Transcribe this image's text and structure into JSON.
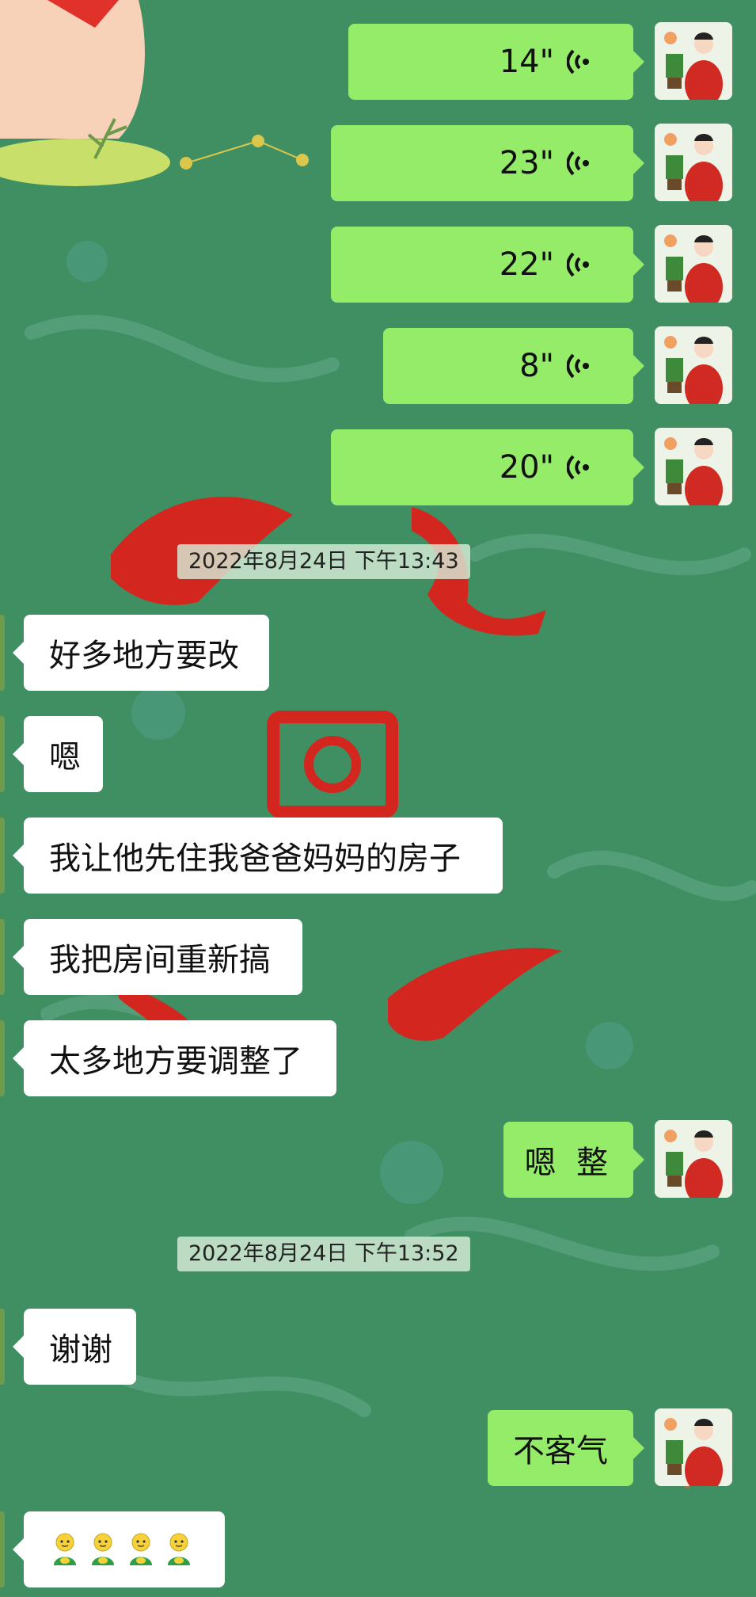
{
  "colors": {
    "background": "#3f8f63",
    "outgoing_bubble": "#95ec69",
    "incoming_bubble": "#ffffff",
    "ornament_red": "#d3261f"
  },
  "chat": {
    "voice_messages": [
      {
        "duration": "14\"",
        "icon": "voice-wave-icon"
      },
      {
        "duration": "23\"",
        "icon": "voice-wave-icon"
      },
      {
        "duration": "22\"",
        "icon": "voice-wave-icon"
      },
      {
        "duration": "8\"",
        "icon": "voice-wave-icon"
      },
      {
        "duration": "20\"",
        "icon": "voice-wave-icon"
      }
    ],
    "timestamp_1": "2022年8月24日  下午13:43",
    "incoming_1": [
      "好多地方要改",
      "嗯",
      "我让他先住我爸爸妈妈的房子",
      "我把房间重新搞",
      "太多地方要调整了"
    ],
    "outgoing_reply_1": "嗯  整",
    "timestamp_2": "2022年8月24日  下午13:52",
    "incoming_2": "谢谢",
    "outgoing_reply_2": "不客气",
    "incoming_emoji": {
      "count": 4,
      "icon": "green-buddy-emoji-icon"
    }
  }
}
